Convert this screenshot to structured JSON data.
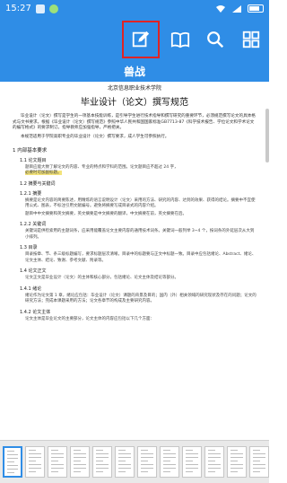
{
  "status_bar": {
    "time": "15:27"
  },
  "toolbar": {
    "edit_icon": "edit-icon",
    "book_icon": "book-icon",
    "search_icon": "search-icon",
    "grid_icon": "grid-icon"
  },
  "doc_band": {
    "title": "兽战"
  },
  "document": {
    "school": "北京信息职业技术学院",
    "title": "毕业设计（论文）撰写规范",
    "intro1": "毕业设计（论文）撰写是学生的一项基本技能训练，是引导学生进行技术指导和撰写研究的重要环节，必须规范撰写论文的具体格式与文书要求。根据《毕业设计（论文）撰写规范》参照中华人民共和国国家标准GB7713-87《科学技术报告、学位论文和学术论文的编写格式》的要求制订。指导教师应加强指导，严格把关。",
    "intro2": "本规范适用于学院高职专业的毕业设计（论文）撰写要求，成人学生可参照执行。",
    "toc": "1 内部基本要求",
    "h1_1": "1.1 论文题目",
    "t1_1a": "题目应能大致了解论文的内容、专业的特点和学科的范围。论文题目应不超过 24 字，",
    "t1_1b": "必要时可加副标题。",
    "h1_2": "1.2 摘要与关键词",
    "h1_2_1": "1.2.1 摘要",
    "t1_2_1": "摘要是论文内容的简要陈述，用精炼的语言说明设计（论文）采用的方法、研究的内容、达到的效果、获得的结论。摘要中不宜使用公式、图表，不标注引用文献编号。避免将摘要写成目录式的内容介绍。",
    "t1_2_1b": "题目中中文摘要和英文摘要，英文摘要是中文摘要的翻译，中文摘要在前，英文摘要在后。",
    "h1_2_2": "1.2.2 关键词",
    "t1_2_2": "关键词是供检索用的主题词条，应采用能覆盖论文主要内容的通用技术词条。关键词一般列举 3~4 个，按词条的外延层次从大到小排列。",
    "h1_3": "1.3 目录",
    "t1_3": "目录按章、节、条三级标题编写，要求标题层次清晰。目录中的标题要与正文中标题一致。目录中应包括绪论、Abstract、绪论、论文主体、结论、致谢、参考文献、附录等。",
    "h1_4": "1.4 论文正文",
    "t1_4": "论文正文是毕业设计（论文）的主体和核心部分，包括绪论、论文主体及结论等部分。",
    "h1_4_1": "1.4.1 绪论",
    "t1_4_1": "绪论作为论文第 1 章，绪论应包括：毕业设计（论文）课题的背景及目的；国内（外）相关领域的研究现状及存在的问题；论文的研究方法；完成本课题采用的方法；论文各章节的构成及主要研究内容。",
    "h1_4_2": "1.4.2 论文主体",
    "t1_4_2": "论文主体是毕业论文的主要部分，论文主体的内容应包括以下几个方面："
  },
  "thumbnails": {
    "count": 12,
    "selected_index": 0
  }
}
